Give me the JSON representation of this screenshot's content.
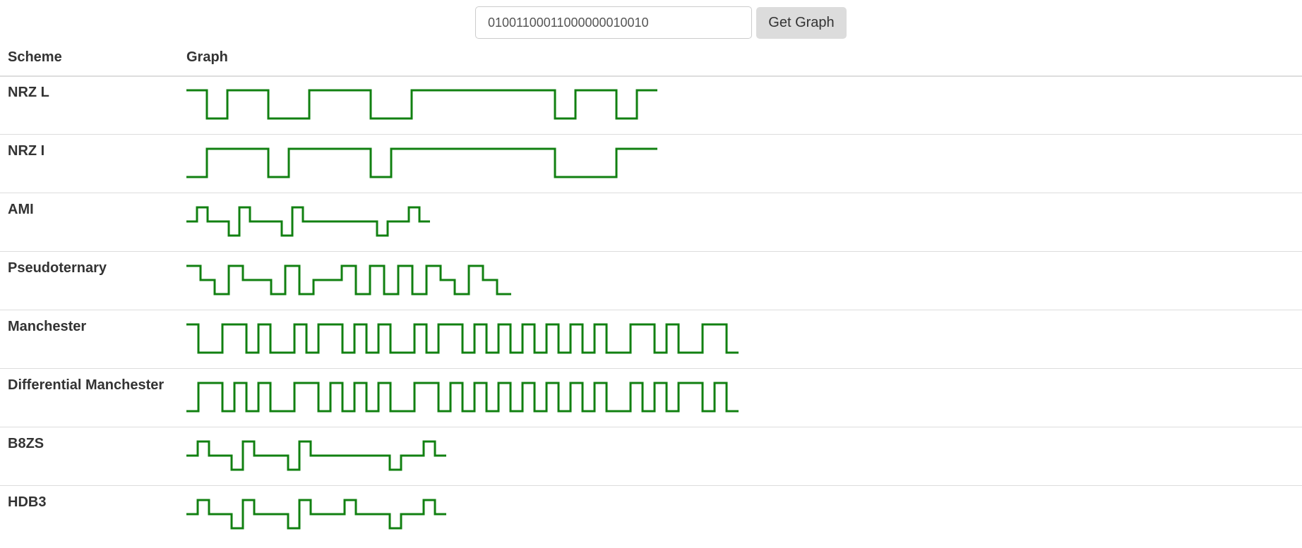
{
  "form": {
    "input_value": "01001100011000000010010",
    "button_label": "Get Graph"
  },
  "table": {
    "headers": {
      "scheme": "Scheme",
      "graph": "Graph"
    },
    "rows": [
      {
        "scheme": "NRZ L"
      },
      {
        "scheme": "NRZ I"
      },
      {
        "scheme": "AMI"
      },
      {
        "scheme": "Pseudoternary"
      },
      {
        "scheme": "Manchester"
      },
      {
        "scheme": "Differential Manchester"
      },
      {
        "scheme": "B8ZS"
      },
      {
        "scheme": "HDB3"
      }
    ]
  },
  "colors": {
    "signal": "#118011"
  }
}
